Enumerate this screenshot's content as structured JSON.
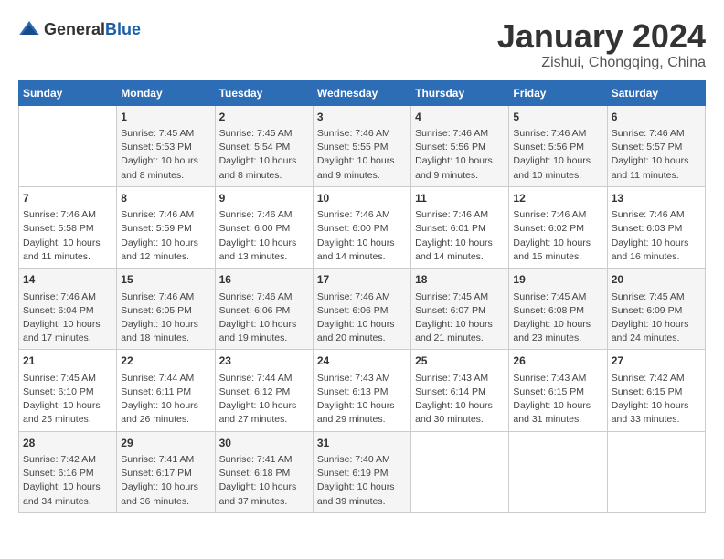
{
  "logo": {
    "text_general": "General",
    "text_blue": "Blue"
  },
  "header": {
    "month": "January 2024",
    "location": "Zishui, Chongqing, China"
  },
  "weekdays": [
    "Sunday",
    "Monday",
    "Tuesday",
    "Wednesday",
    "Thursday",
    "Friday",
    "Saturday"
  ],
  "weeks": [
    [
      {
        "day": "",
        "content": ""
      },
      {
        "day": "1",
        "content": "Sunrise: 7:45 AM\nSunset: 5:53 PM\nDaylight: 10 hours\nand 8 minutes."
      },
      {
        "day": "2",
        "content": "Sunrise: 7:45 AM\nSunset: 5:54 PM\nDaylight: 10 hours\nand 8 minutes."
      },
      {
        "day": "3",
        "content": "Sunrise: 7:46 AM\nSunset: 5:55 PM\nDaylight: 10 hours\nand 9 minutes."
      },
      {
        "day": "4",
        "content": "Sunrise: 7:46 AM\nSunset: 5:56 PM\nDaylight: 10 hours\nand 9 minutes."
      },
      {
        "day": "5",
        "content": "Sunrise: 7:46 AM\nSunset: 5:56 PM\nDaylight: 10 hours\nand 10 minutes."
      },
      {
        "day": "6",
        "content": "Sunrise: 7:46 AM\nSunset: 5:57 PM\nDaylight: 10 hours\nand 11 minutes."
      }
    ],
    [
      {
        "day": "7",
        "content": "Sunrise: 7:46 AM\nSunset: 5:58 PM\nDaylight: 10 hours\nand 11 minutes."
      },
      {
        "day": "8",
        "content": "Sunrise: 7:46 AM\nSunset: 5:59 PM\nDaylight: 10 hours\nand 12 minutes."
      },
      {
        "day": "9",
        "content": "Sunrise: 7:46 AM\nSunset: 6:00 PM\nDaylight: 10 hours\nand 13 minutes."
      },
      {
        "day": "10",
        "content": "Sunrise: 7:46 AM\nSunset: 6:00 PM\nDaylight: 10 hours\nand 14 minutes."
      },
      {
        "day": "11",
        "content": "Sunrise: 7:46 AM\nSunset: 6:01 PM\nDaylight: 10 hours\nand 14 minutes."
      },
      {
        "day": "12",
        "content": "Sunrise: 7:46 AM\nSunset: 6:02 PM\nDaylight: 10 hours\nand 15 minutes."
      },
      {
        "day": "13",
        "content": "Sunrise: 7:46 AM\nSunset: 6:03 PM\nDaylight: 10 hours\nand 16 minutes."
      }
    ],
    [
      {
        "day": "14",
        "content": "Sunrise: 7:46 AM\nSunset: 6:04 PM\nDaylight: 10 hours\nand 17 minutes."
      },
      {
        "day": "15",
        "content": "Sunrise: 7:46 AM\nSunset: 6:05 PM\nDaylight: 10 hours\nand 18 minutes."
      },
      {
        "day": "16",
        "content": "Sunrise: 7:46 AM\nSunset: 6:06 PM\nDaylight: 10 hours\nand 19 minutes."
      },
      {
        "day": "17",
        "content": "Sunrise: 7:46 AM\nSunset: 6:06 PM\nDaylight: 10 hours\nand 20 minutes."
      },
      {
        "day": "18",
        "content": "Sunrise: 7:45 AM\nSunset: 6:07 PM\nDaylight: 10 hours\nand 21 minutes."
      },
      {
        "day": "19",
        "content": "Sunrise: 7:45 AM\nSunset: 6:08 PM\nDaylight: 10 hours\nand 23 minutes."
      },
      {
        "day": "20",
        "content": "Sunrise: 7:45 AM\nSunset: 6:09 PM\nDaylight: 10 hours\nand 24 minutes."
      }
    ],
    [
      {
        "day": "21",
        "content": "Sunrise: 7:45 AM\nSunset: 6:10 PM\nDaylight: 10 hours\nand 25 minutes."
      },
      {
        "day": "22",
        "content": "Sunrise: 7:44 AM\nSunset: 6:11 PM\nDaylight: 10 hours\nand 26 minutes."
      },
      {
        "day": "23",
        "content": "Sunrise: 7:44 AM\nSunset: 6:12 PM\nDaylight: 10 hours\nand 27 minutes."
      },
      {
        "day": "24",
        "content": "Sunrise: 7:43 AM\nSunset: 6:13 PM\nDaylight: 10 hours\nand 29 minutes."
      },
      {
        "day": "25",
        "content": "Sunrise: 7:43 AM\nSunset: 6:14 PM\nDaylight: 10 hours\nand 30 minutes."
      },
      {
        "day": "26",
        "content": "Sunrise: 7:43 AM\nSunset: 6:15 PM\nDaylight: 10 hours\nand 31 minutes."
      },
      {
        "day": "27",
        "content": "Sunrise: 7:42 AM\nSunset: 6:15 PM\nDaylight: 10 hours\nand 33 minutes."
      }
    ],
    [
      {
        "day": "28",
        "content": "Sunrise: 7:42 AM\nSunset: 6:16 PM\nDaylight: 10 hours\nand 34 minutes."
      },
      {
        "day": "29",
        "content": "Sunrise: 7:41 AM\nSunset: 6:17 PM\nDaylight: 10 hours\nand 36 minutes."
      },
      {
        "day": "30",
        "content": "Sunrise: 7:41 AM\nSunset: 6:18 PM\nDaylight: 10 hours\nand 37 minutes."
      },
      {
        "day": "31",
        "content": "Sunrise: 7:40 AM\nSunset: 6:19 PM\nDaylight: 10 hours\nand 39 minutes."
      },
      {
        "day": "",
        "content": ""
      },
      {
        "day": "",
        "content": ""
      },
      {
        "day": "",
        "content": ""
      }
    ]
  ]
}
